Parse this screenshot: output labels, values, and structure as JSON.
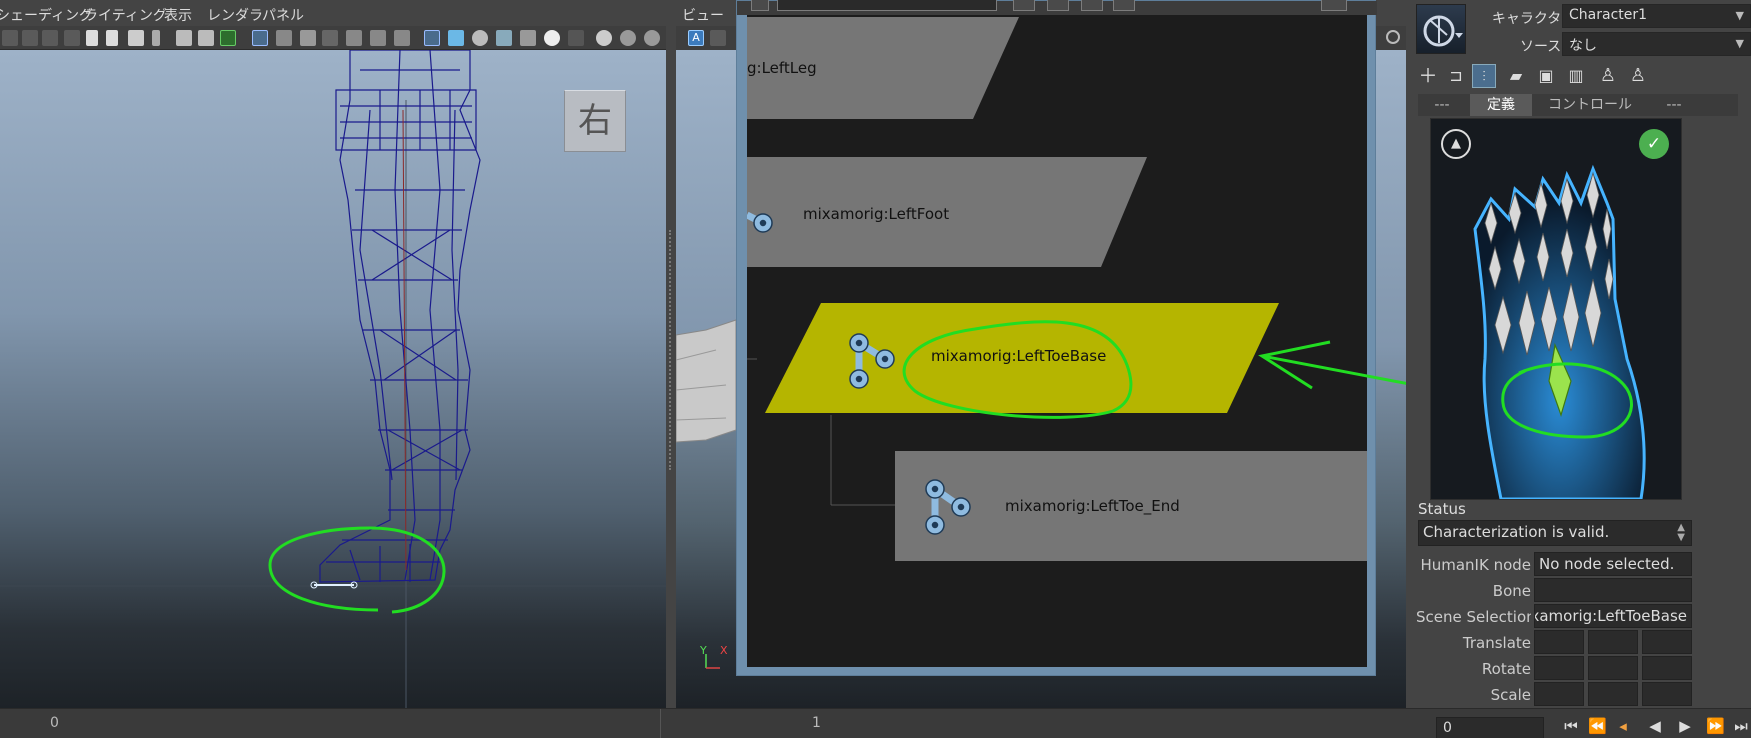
{
  "left_viewport": {
    "menu": [
      "シェーディング",
      "ライティング",
      "表示",
      "レンダラ",
      "パネル"
    ],
    "view_cube_label": "右",
    "timeline_start": "0"
  },
  "middle_viewport": {
    "menu": [
      "ビュー"
    ],
    "timeline_mark": "1",
    "axis_labels": {
      "y": "Y",
      "x": "X"
    }
  },
  "hierarchy_window": {
    "nodes": [
      {
        "label": "g:LeftLeg",
        "state": "normal"
      },
      {
        "label": "mixamorig:LeftFoot",
        "state": "normal"
      },
      {
        "label": "mixamorig:LeftToeBase",
        "state": "selected"
      },
      {
        "label": "mixamorig:LeftToe_End",
        "state": "normal"
      }
    ],
    "colors": {
      "selected_fill": "#b5b500",
      "node_fill": "#767676",
      "background": "#1c1c1c",
      "annotation": "#22dd22"
    }
  },
  "right_panel": {
    "character_label": "キャラクタ:",
    "character_value": "Character1",
    "source_label": "ソース:",
    "source_value": "なし",
    "tabs": [
      "---",
      "定義",
      "コントロール",
      "---"
    ],
    "active_tab": "定義",
    "status_label": "Status",
    "status_value": "Characterization is valid.",
    "fields": [
      {
        "label": "HumanIK node",
        "value": "No node selected."
      },
      {
        "label": "Bone",
        "value": ""
      },
      {
        "label": "Scene Selection",
        "value": "mixamorig:LeftToeBase"
      }
    ],
    "transforms": [
      {
        "label": "Translate"
      },
      {
        "label": "Rotate"
      },
      {
        "label": "Scale"
      }
    ],
    "tool_icons": [
      "add-icon",
      "unlock-icon",
      "skeleton-icon",
      "folder-icon",
      "save-icon",
      "delete-icon",
      "character-icon",
      "character-alt-icon"
    ]
  },
  "timeline": {
    "current_frame": "0",
    "buttons": [
      "go-to-start-icon",
      "step-back-key-icon",
      "step-back-icon",
      "play-back-icon",
      "play-forward-icon",
      "step-forward-key-icon",
      "go-to-end-icon"
    ]
  }
}
